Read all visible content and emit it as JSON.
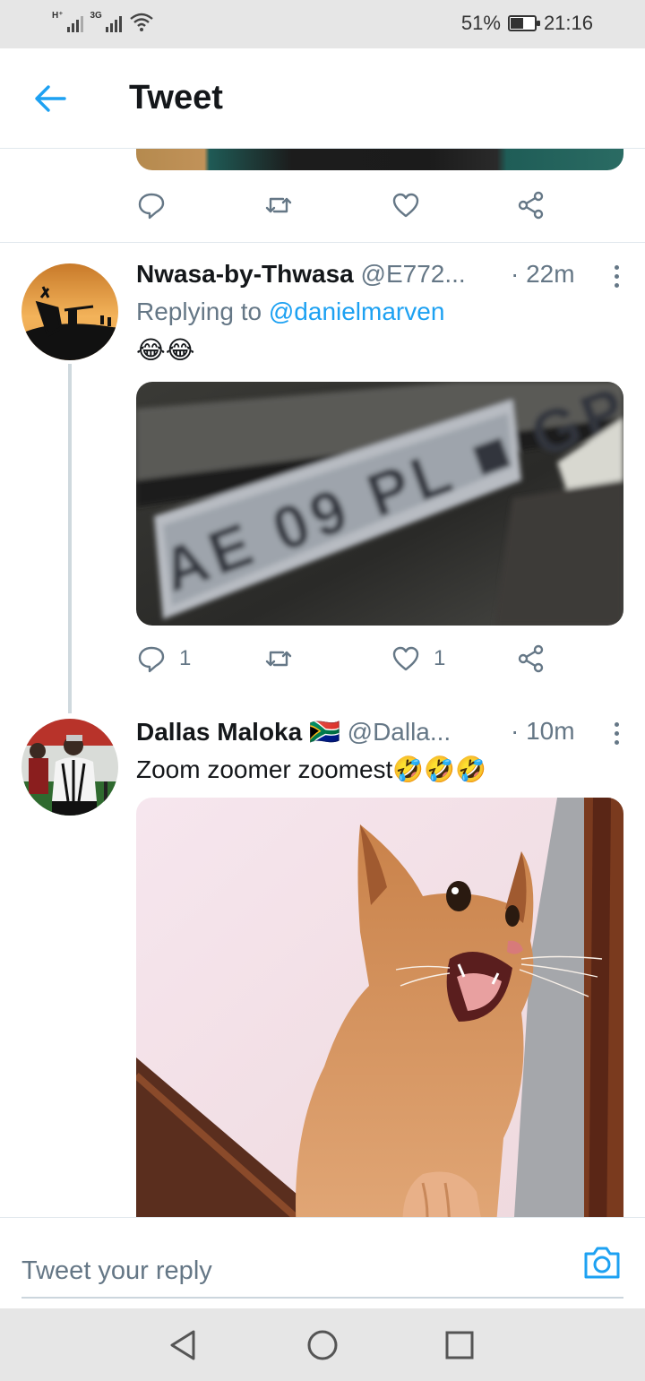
{
  "status_bar": {
    "network_1": "H⁺",
    "network_2": "3G",
    "battery_percent": "51%",
    "battery_level": 0.51,
    "time": "21:16",
    "icons": [
      "signal-icon",
      "signal-icon",
      "wifi-icon",
      "battery-icon"
    ]
  },
  "header": {
    "title": "Tweet",
    "back_icon": "arrow-left-icon"
  },
  "previous_tweet": {
    "actions": {
      "reply_count": "",
      "retweet_count": "",
      "like_count": ""
    }
  },
  "tweets": [
    {
      "name": "Nwasa-by-Thwasa",
      "handle": "@E772...",
      "time": "· 22m",
      "replying_prefix": "Replying to ",
      "replying_handle": "@danielmarven",
      "text": "😂😂",
      "media_alt": "blurred license plate photo",
      "actions": {
        "reply_count": "1",
        "retweet_count": "",
        "like_count": "1"
      }
    },
    {
      "name": "Dallas Maloka",
      "flag": "🇿🇦",
      "handle": "@Dalla...",
      "time": "· 10m",
      "text": "Zoom zoomer zoomest🤣🤣🤣",
      "media_alt": "screaming cat photo"
    }
  ],
  "reply_bar": {
    "placeholder": "Tweet your reply",
    "camera_icon": "camera-icon"
  },
  "colors": {
    "accent": "#1da1f2",
    "secondary_text": "#657786",
    "divider": "#e1e8ed"
  }
}
